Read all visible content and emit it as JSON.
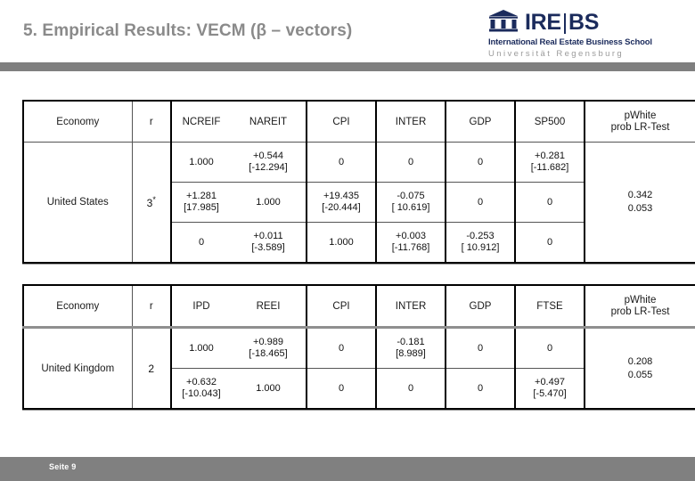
{
  "slide": {
    "title": "5. Empirical Results: VECM (β – vectors)",
    "footer_page": "Seite 9"
  },
  "logo": {
    "icon": "classical-building-icon",
    "mark_left": "IRE",
    "mark_bar": "|",
    "mark_right": "BS",
    "subtitle_1": "International Real Estate Business School",
    "subtitle_2": "Universität Regensburg",
    "color_navy": "#1b2b5c",
    "color_gray": "#9b9b9b"
  },
  "tables": [
    {
      "id": "united-states",
      "headers": [
        "Economy",
        "r",
        "NCREIF",
        "NAREIT",
        "CPI",
        "INTER",
        "GDP",
        "SP500",
        "pWhite\nprob LR-Test"
      ],
      "header_pwhite_line1": "pWhite",
      "header_pwhite_line2": "prob LR-Test",
      "economy": "United States",
      "r": "3",
      "r_star": "*",
      "pwhite": "0.342",
      "prob_lr": "0.053",
      "rows": [
        {
          "cells": [
            {
              "value": "1.000",
              "t": ""
            },
            {
              "value": "+0.544",
              "t": "[-12.294]"
            },
            {
              "value": "0",
              "t": ""
            },
            {
              "value": "0",
              "t": ""
            },
            {
              "value": "0",
              "t": ""
            },
            {
              "value": "+0.281",
              "t": "[-11.682]"
            }
          ]
        },
        {
          "cells": [
            {
              "value": "+1.281",
              "t": "[17.985]"
            },
            {
              "value": "1.000",
              "t": ""
            },
            {
              "value": "+19.435",
              "t": "[-20.444]"
            },
            {
              "value": "-0.075",
              "t": "[ 10.619]"
            },
            {
              "value": "0",
              "t": ""
            },
            {
              "value": "0",
              "t": ""
            }
          ]
        },
        {
          "cells": [
            {
              "value": "0",
              "t": ""
            },
            {
              "value": "+0.011",
              "t": "[-3.589]"
            },
            {
              "value": "1.000",
              "t": ""
            },
            {
              "value": "+0.003",
              "t": "[-11.768]"
            },
            {
              "value": "-0.253",
              "t": "[ 10.912]"
            },
            {
              "value": "0",
              "t": ""
            }
          ]
        }
      ]
    },
    {
      "id": "united-kingdom",
      "headers": [
        "Economy",
        "r",
        "IPD",
        "REEI",
        "CPI",
        "INTER",
        "GDP",
        "FTSE",
        "pWhite\nprob LR-Test"
      ],
      "header_pwhite_line1": "pWhite",
      "header_pwhite_line2": "prob LR-Test",
      "economy": "United Kingdom",
      "r": "2",
      "r_star": "",
      "pwhite": "0.208",
      "prob_lr": "0.055",
      "rows": [
        {
          "cells": [
            {
              "value": "1.000",
              "t": ""
            },
            {
              "value": "+0.989",
              "t": "[-18.465]"
            },
            {
              "value": "0",
              "t": ""
            },
            {
              "value": "-0.181",
              "t": "[8.989]"
            },
            {
              "value": "0",
              "t": ""
            },
            {
              "value": "0",
              "t": ""
            }
          ]
        },
        {
          "cells": [
            {
              "value": "+0.632",
              "t": "[-10.043]"
            },
            {
              "value": "1.000",
              "t": ""
            },
            {
              "value": "0",
              "t": ""
            },
            {
              "value": "0",
              "t": ""
            },
            {
              "value": "0",
              "t": ""
            },
            {
              "value": "+0.497",
              "t": "[-5.470]"
            }
          ]
        }
      ]
    }
  ]
}
